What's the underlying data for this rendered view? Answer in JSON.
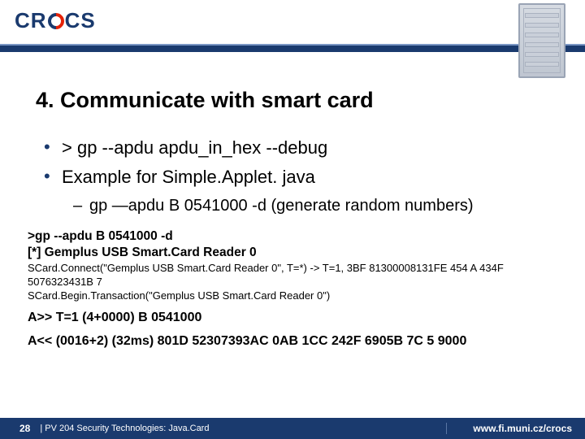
{
  "header": {
    "logo_left": "CR",
    "logo_right": "CS",
    "url": "www.fi.muni.cz/crocs"
  },
  "title": "4. Communicate with smart card",
  "bullets": [
    "> gp --apdu  apdu_in_hex --debug",
    "Example for Simple.Applet. java"
  ],
  "sub_bullet": "gp —apdu B 0541000 -d (generate random numbers)",
  "code": {
    "line1": ">gp --apdu B 0541000 -d",
    "line2": "[*] Gemplus USB Smart.Card Reader 0",
    "line3": "SCard.Connect(\"Gemplus USB Smart.Card Reader 0\", T=*) -> T=1, 3BF 81300008131FE 454 A 434F 5076323431B 7",
    "line4": "SCard.Begin.Transaction(\"Gemplus USB Smart.Card Reader 0\")",
    "aline1": "A>> T=1 (4+0000) B 0541000",
    "aline2": "A<< (0016+2) (32ms) 801D 52307393AC 0AB 1CC 242F 6905B 7C 5 9000"
  },
  "footer": {
    "page": "28",
    "text": "| PV 204 Security Technologies: Java.Card"
  }
}
